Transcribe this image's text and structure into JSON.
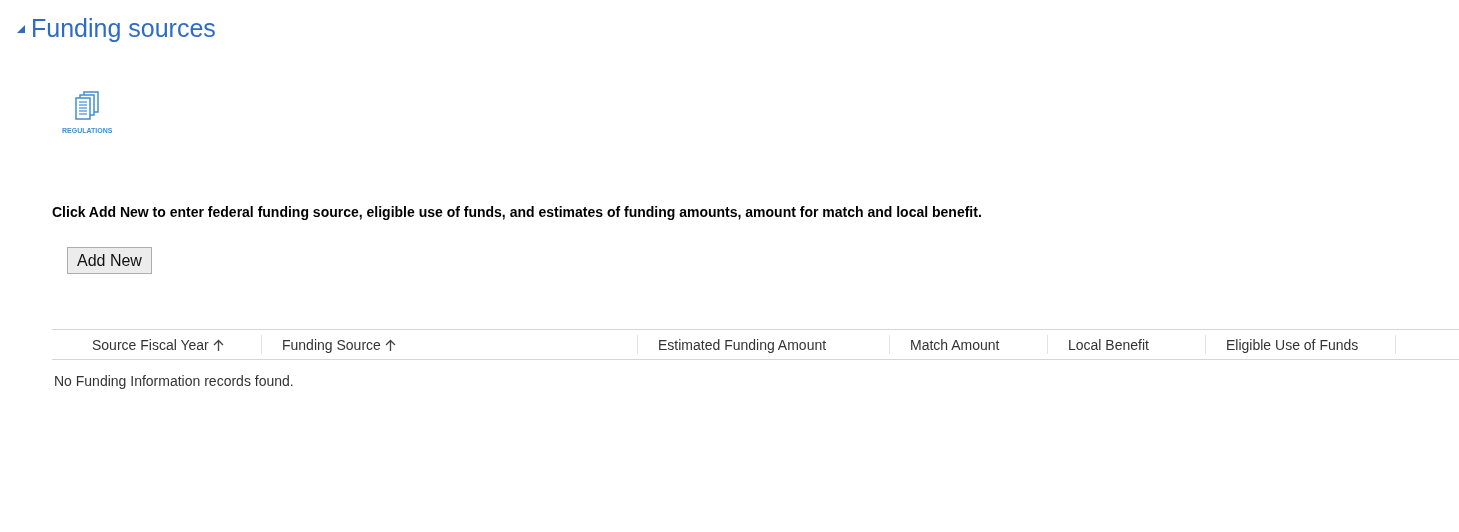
{
  "section": {
    "title": "Funding sources",
    "expanded": true
  },
  "toolbar": [
    {
      "label": "REGULATIONS"
    }
  ],
  "instructions": "Click Add New to enter federal funding source, eligible use of funds, and estimates of funding amounts, amount for match and local benefit.",
  "add_button": "Add New",
  "table": {
    "columns": [
      {
        "label": "Source Fiscal Year",
        "sorted_ascending": true
      },
      {
        "label": "Funding Source",
        "sorted_ascending": true
      },
      {
        "label": "Estimated Funding Amount",
        "sorted_ascending": false
      },
      {
        "label": "Match Amount",
        "sorted_ascending": false
      },
      {
        "label": "Local Benefit",
        "sorted_ascending": false
      },
      {
        "label": "Eligible Use of Funds",
        "sorted_ascending": false
      }
    ],
    "empty_message": "No Funding Information records found."
  }
}
